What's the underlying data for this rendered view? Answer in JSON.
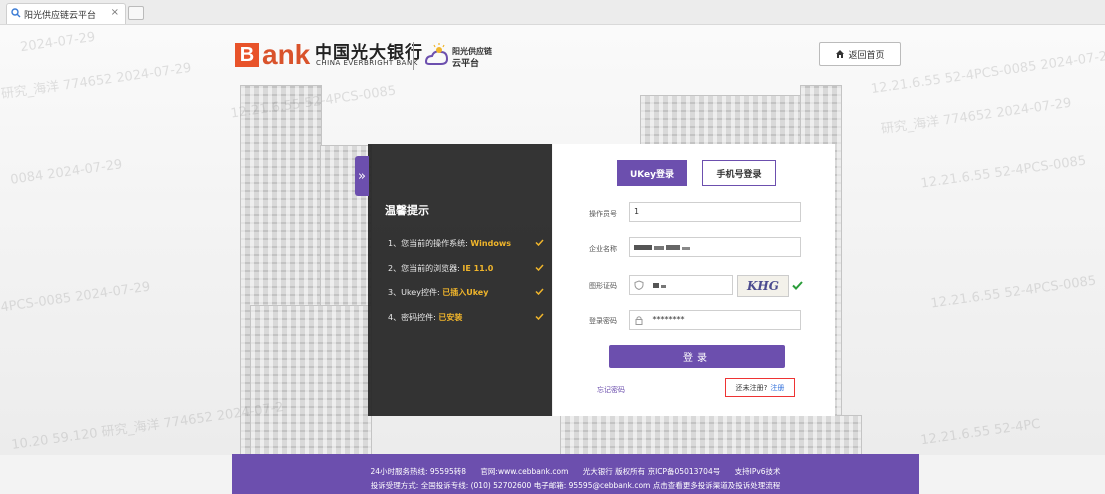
{
  "browser": {
    "tab_title": "阳光供应链云平台",
    "tab_close": "×"
  },
  "header": {
    "logo_b": "B",
    "logo_ank": "ank",
    "bank_cn": "中国光大银行",
    "bank_en": "CHINA EVERBRIGHT BANK",
    "platform_line1": "阳光供应链",
    "platform_line2": "云平台",
    "home_label": "返回首页"
  },
  "tips": {
    "expand_glyph": "»",
    "title": "温馨提示",
    "items": [
      {
        "prefix": "1、您当前的操作系统:",
        "value": "Windows"
      },
      {
        "prefix": "2、您当前的浏览器:",
        "value": "IE 11.0"
      },
      {
        "prefix": "3、Ukey控件:",
        "value": "已插入Ukey"
      },
      {
        "prefix": "4、密码控件:",
        "value": "已安装"
      }
    ]
  },
  "login": {
    "tab_ukey": "UKey登录",
    "tab_phone": "手机号登录",
    "operator_label": "操作员号",
    "operator_value": "1",
    "company_label": "企业名称",
    "captcha_label": "图形证码",
    "captcha_text": "KHG",
    "password_label": "登录密码",
    "password_value": "********",
    "submit_label": "登录",
    "forgot_label": "忘记密码",
    "not_registered": "还未注册?",
    "register_link": "注册"
  },
  "footer": {
    "hotline": "24小时服务热线: 95595转8",
    "website": "官网:www.cebbank.com",
    "copyright": "光大银行 版权所有 京ICP备05013704号",
    "ipv6": "支持IPv6技术",
    "complaint": "投诉受理方式: 全国投诉专线: (010) 52702600 电子邮箱: 95595@cebbank.com 点击查看更多投诉渠道及投诉处理流程"
  },
  "colors": {
    "brand_purple": "#6c4fae",
    "logo_orange": "#e8532a",
    "tip_highlight": "#f0b52b",
    "register_border": "#e33333"
  }
}
